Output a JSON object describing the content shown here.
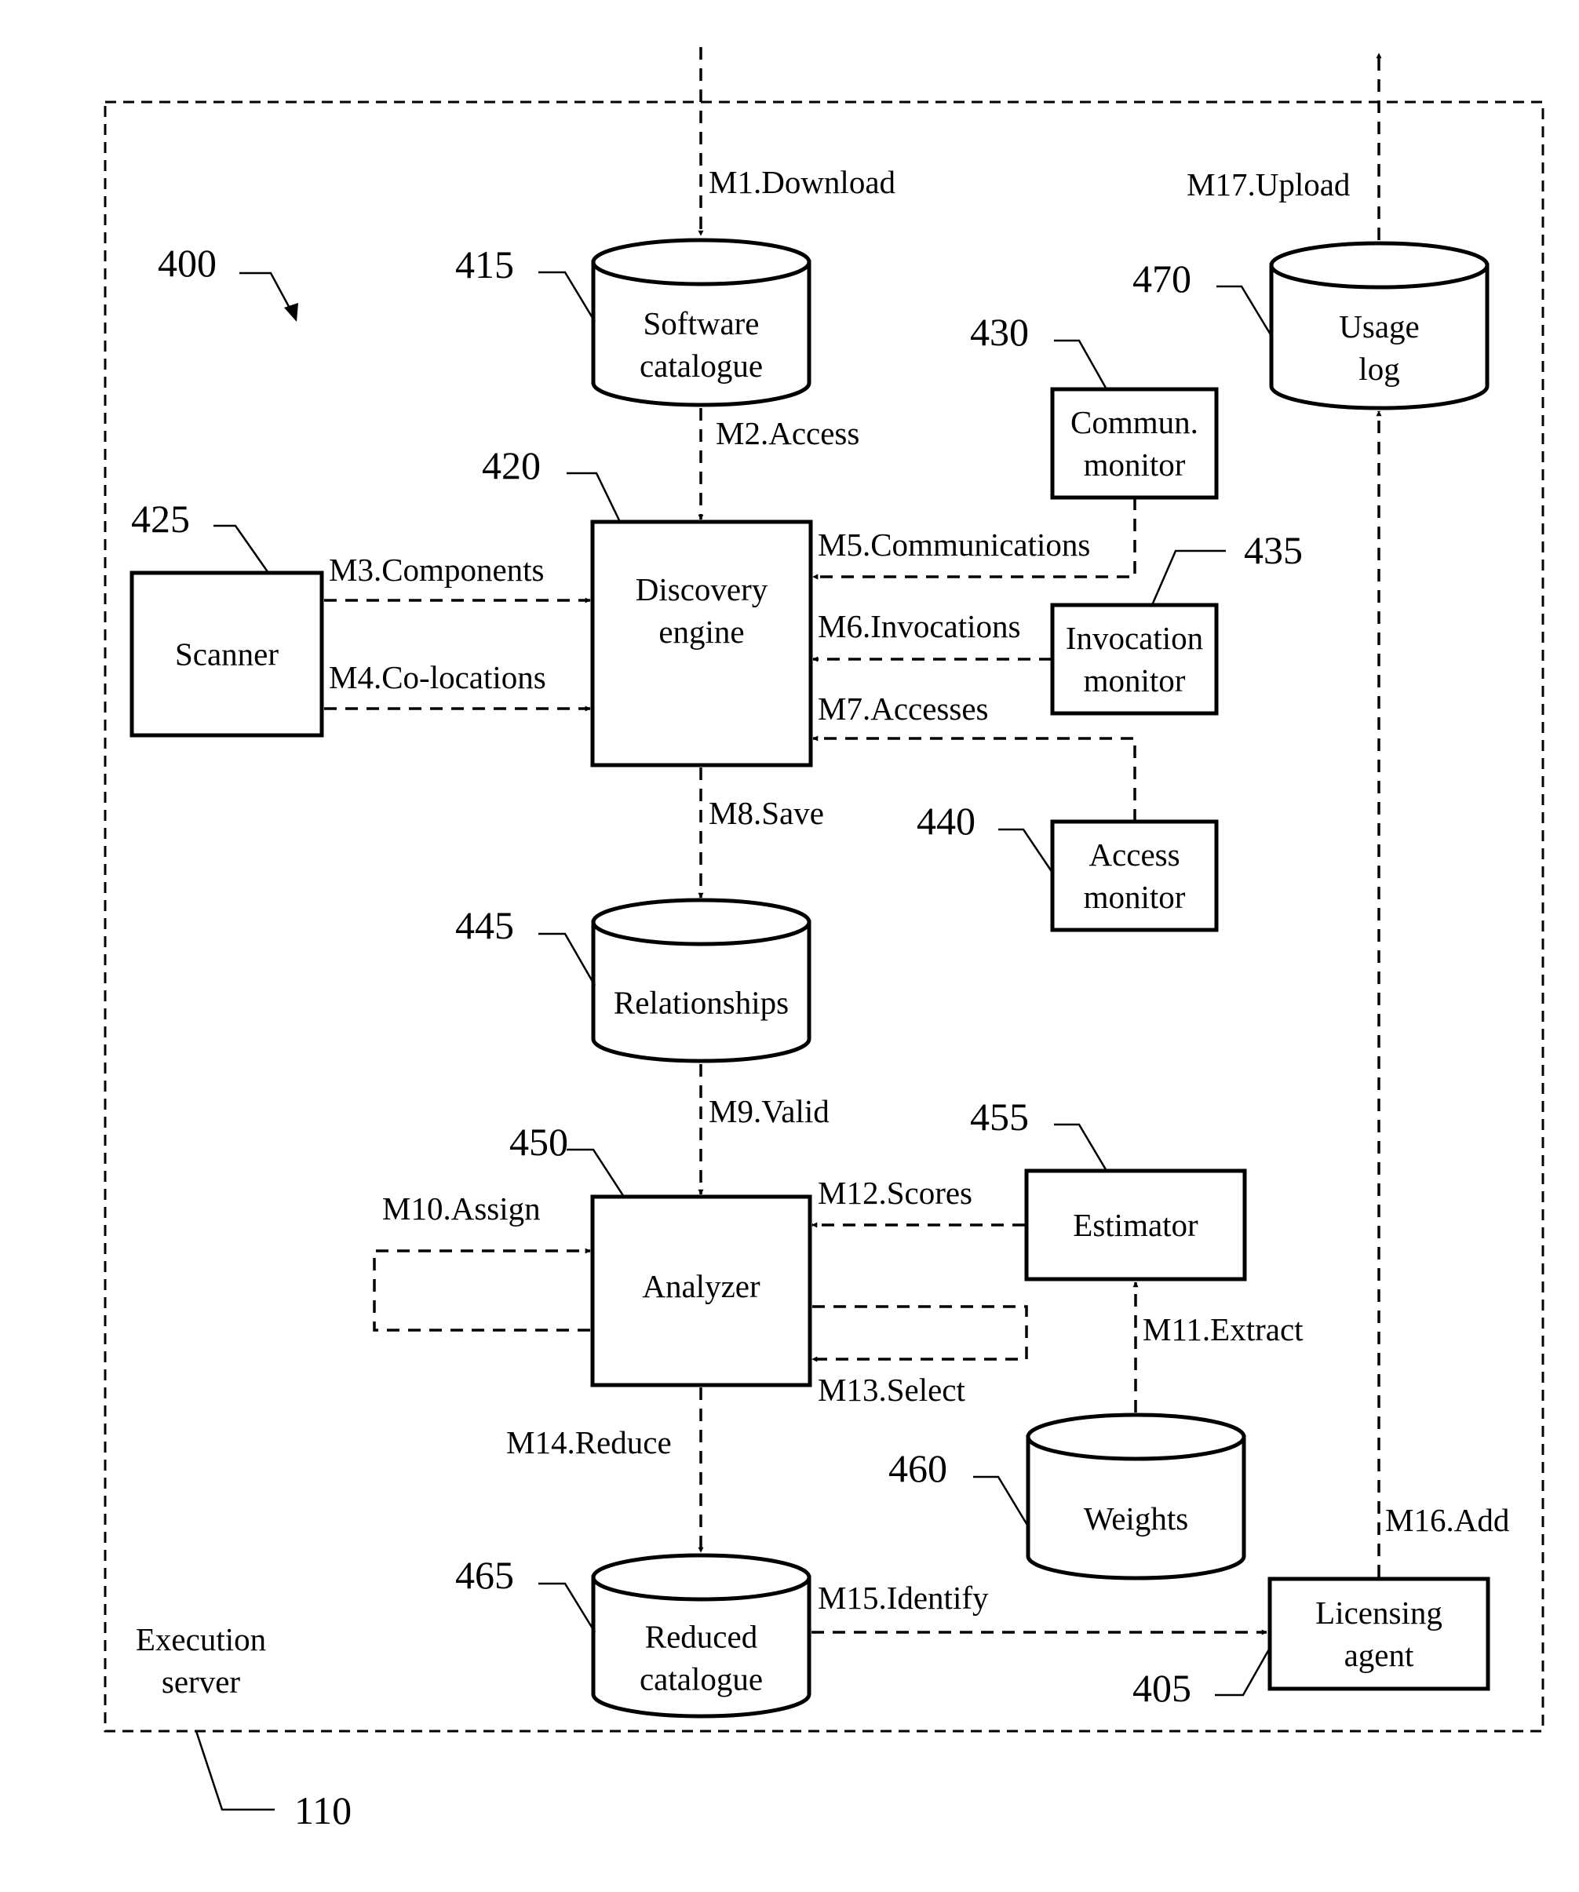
{
  "figure": {
    "ref": "400",
    "container": {
      "label_line1": "Execution",
      "label_line2": "server",
      "ref": "110"
    }
  },
  "nodes": {
    "licensing_agent": {
      "ref": "405",
      "line1": "Licensing",
      "line2": "agent",
      "shape": "box"
    },
    "software_catalogue": {
      "ref": "415",
      "line1": "Software",
      "line2": "catalogue",
      "shape": "cylinder"
    },
    "discovery_engine": {
      "ref": "420",
      "line1": "Discovery",
      "line2": "engine",
      "shape": "box"
    },
    "scanner": {
      "ref": "425",
      "line1": "Scanner",
      "shape": "box"
    },
    "commun_monitor": {
      "ref": "430",
      "line1": "Commun.",
      "line2": "monitor",
      "shape": "box"
    },
    "invocation_monitor": {
      "ref": "435",
      "line1": "Invocation",
      "line2": "monitor",
      "shape": "box"
    },
    "access_monitor": {
      "ref": "440",
      "line1": "Access",
      "line2": "monitor",
      "shape": "box"
    },
    "relationships": {
      "ref": "445",
      "line1": "Relationships",
      "shape": "cylinder"
    },
    "analyzer": {
      "ref": "450",
      "line1": "Analyzer",
      "shape": "box"
    },
    "estimator": {
      "ref": "455",
      "line1": "Estimator",
      "shape": "box"
    },
    "weights": {
      "ref": "460",
      "line1": "Weights",
      "shape": "cylinder"
    },
    "reduced_catalogue": {
      "ref": "465",
      "line1": "Reduced",
      "line2": "catalogue",
      "shape": "cylinder"
    },
    "usage_log": {
      "ref": "470",
      "line1": "Usage",
      "line2": "log",
      "shape": "cylinder"
    }
  },
  "messages": {
    "m1": "M1.Download",
    "m2": "M2.Access",
    "m3": "M3.Components",
    "m4": "M4.Co-locations",
    "m5": "M5.Communications",
    "m6": "M6.Invocations",
    "m7": "M7.Accesses",
    "m8": "M8.Save",
    "m9": "M9.Valid",
    "m10": "M10.Assign",
    "m11": "M11.Extract",
    "m12": "M12.Scores",
    "m13": "M13.Select",
    "m14": "M14.Reduce",
    "m15": "M15.Identify",
    "m16": "M16.Add",
    "m17": "M17.Upload"
  }
}
